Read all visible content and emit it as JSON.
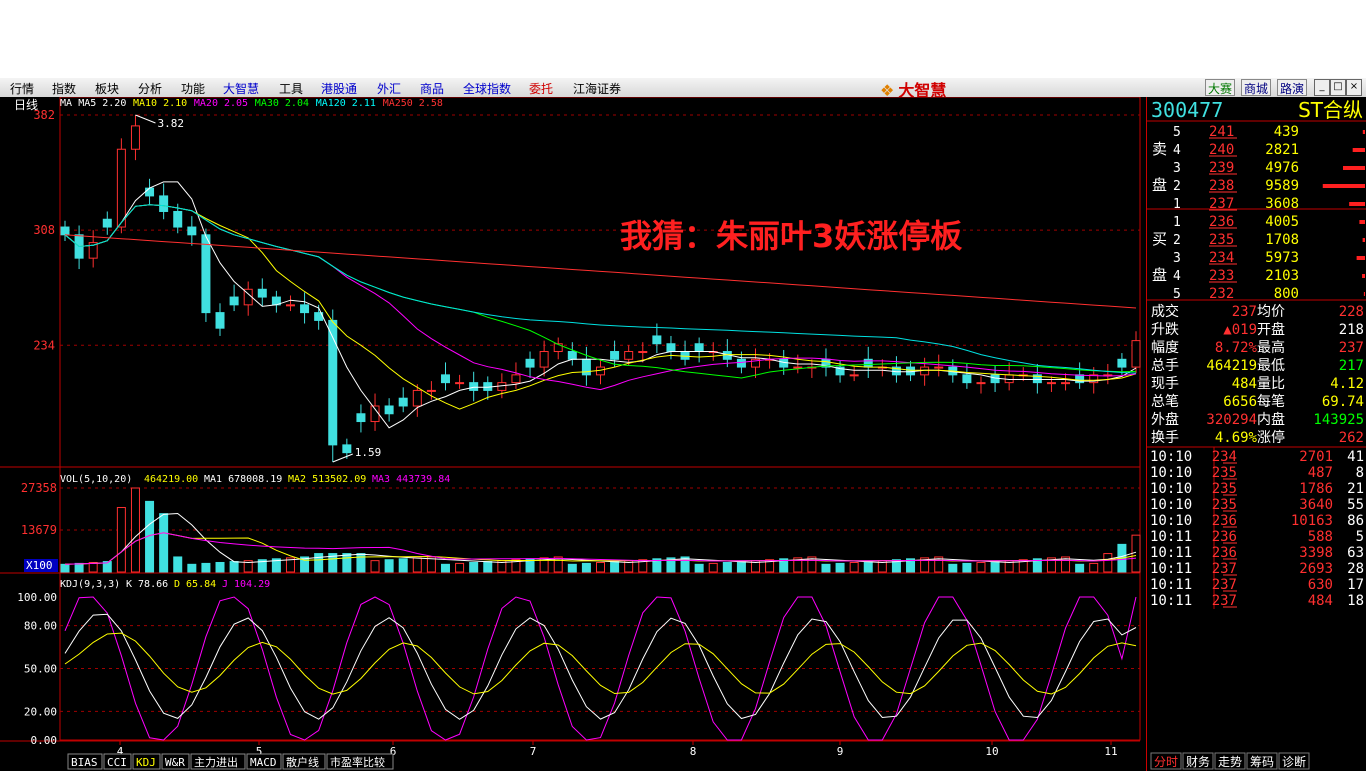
{
  "menu": [
    "行情",
    "指数",
    "板块",
    "分析",
    "功能",
    "大智慧",
    "工具",
    "港股通",
    "外汇",
    "商品",
    "全球指数",
    "委托",
    "江海证券"
  ],
  "brand": "大智慧",
  "top_right_buttons": [
    "大赛",
    "商城",
    "路演"
  ],
  "window_controls": [
    "_",
    "□",
    "×"
  ],
  "chart": {
    "period": "日线",
    "ma_line": [
      {
        "label": "MA",
        "value": "",
        "color": "#ffffff"
      },
      {
        "label": "MA5",
        "value": "2.20",
        "color": "#ffffff"
      },
      {
        "label": "MA10",
        "value": "2.10",
        "color": "#ffff00"
      },
      {
        "label": "MA20",
        "value": "2.05",
        "color": "#ff00ff"
      },
      {
        "label": "MA30",
        "value": "2.04",
        "color": "#00ff00"
      },
      {
        "label": "MA120",
        "value": "2.11",
        "color": "#00ffff"
      },
      {
        "label": "MA250",
        "value": "2.58",
        "color": "#ff3333"
      }
    ],
    "price_ticks": [
      "382",
      "308",
      "234"
    ],
    "high_label": "3.82",
    "low_label": "1.59",
    "annotation": "我猜：朱丽叶3妖涨停板",
    "vol_header": {
      "label": "VOL(5,10,20)",
      "vol": "464219.00",
      "ma1": "MA1 678008.19",
      "ma2": "MA2 513502.09",
      "ma3": "MA3 443739.84"
    },
    "vol_ticks": [
      "27358",
      "13679",
      "X100"
    ],
    "kdj_header": {
      "label": "KDJ(9,3,3)",
      "k": "K 78.66",
      "d": "D 65.84",
      "j": "J 104.29"
    },
    "kdj_ticks": [
      "100.00",
      "80.00",
      "50.00",
      "20.00",
      "0.00"
    ],
    "x_ticks": [
      "4",
      "5",
      "6",
      "7",
      "8",
      "9",
      "10",
      "11"
    ],
    "bottom_tabs": [
      "BIAS",
      "CCI",
      "KDJ",
      "W&R",
      "主力进出",
      "MACD",
      "散户线",
      "市盈率比较"
    ]
  },
  "chart_data": {
    "type": "candlestick",
    "x_ticks": [
      "4",
      "5",
      "6",
      "7",
      "8",
      "9",
      "10",
      "11"
    ],
    "ylim": [
      1.59,
      3.82
    ],
    "y_ticks": [
      3.82,
      3.08,
      2.34
    ],
    "approx_close": [
      3.05,
      2.9,
      3.0,
      3.1,
      3.6,
      3.75,
      3.3,
      3.2,
      3.1,
      3.05,
      2.55,
      2.45,
      2.6,
      2.7,
      2.65,
      2.6,
      2.6,
      2.55,
      2.5,
      1.7,
      1.65,
      1.85,
      1.95,
      1.9,
      1.95,
      2.05,
      2.05,
      2.1,
      2.1,
      2.05,
      2.05,
      2.1,
      2.15,
      2.2,
      2.3,
      2.35,
      2.25,
      2.15,
      2.2,
      2.25,
      2.3,
      2.3,
      2.35,
      2.3,
      2.25,
      2.3,
      2.3,
      2.25,
      2.2,
      2.25,
      2.25,
      2.2,
      2.2,
      2.2,
      2.2,
      2.15,
      2.15,
      2.2,
      2.2,
      2.15,
      2.15,
      2.2,
      2.2,
      2.15,
      2.1,
      2.1,
      2.1,
      2.15,
      2.15,
      2.1,
      2.1,
      2.1,
      2.1,
      2.15,
      2.15,
      2.2,
      2.37
    ]
  },
  "quote": {
    "code": "300477",
    "name": "ST合纵",
    "sell_label": [
      "卖",
      "盘"
    ],
    "buy_label": [
      "买",
      "盘"
    ],
    "sell": [
      {
        "lvl": "5",
        "price": "241",
        "vol": "439",
        "bar": 0.05
      },
      {
        "lvl": "4",
        "price": "240",
        "vol": "2821",
        "bar": 0.28
      },
      {
        "lvl": "3",
        "price": "239",
        "vol": "4976",
        "bar": 0.5
      },
      {
        "lvl": "2",
        "price": "238",
        "vol": "9589",
        "bar": 0.96
      },
      {
        "lvl": "1",
        "price": "237",
        "vol": "3608",
        "bar": 0.36
      }
    ],
    "buy": [
      {
        "lvl": "1",
        "price": "236",
        "vol": "4005",
        "bar": 0.4
      },
      {
        "lvl": "2",
        "price": "235",
        "vol": "1708",
        "bar": 0.17
      },
      {
        "lvl": "3",
        "price": "234",
        "vol": "5973",
        "bar": 0.6
      },
      {
        "lvl": "4",
        "price": "233",
        "vol": "2103",
        "bar": 0.21
      },
      {
        "lvl": "5",
        "price": "232",
        "vol": "800",
        "bar": 0.08
      }
    ],
    "stats": [
      {
        "l1": "成交",
        "v1": "237",
        "c1": "#ff3030",
        "l2": "均价",
        "v2": "228",
        "c2": "#ff3030"
      },
      {
        "l1": "升跌",
        "v1": "▲019",
        "c1": "#ff3030",
        "l2": "开盘",
        "v2": "218",
        "c2": "#ffffff"
      },
      {
        "l1": "幅度",
        "v1": "8.72%",
        "c1": "#ff3030",
        "l2": "最高",
        "v2": "237",
        "c2": "#ff3030"
      },
      {
        "l1": "总手",
        "v1": "464219",
        "c1": "#ffff00",
        "l2": "最低",
        "v2": "217",
        "c2": "#00ff00"
      },
      {
        "l1": "现手",
        "v1": "484",
        "c1": "#ffff00",
        "l2": "量比",
        "v2": "4.12",
        "c2": "#ffff00"
      },
      {
        "l1": "总笔",
        "v1": "6656",
        "c1": "#ffff00",
        "l2": "每笔",
        "v2": "69.74",
        "c2": "#ffff00"
      },
      {
        "l1": "外盘",
        "v1": "320294",
        "c1": "#ff3030",
        "l2": "内盘",
        "v2": "143925",
        "c2": "#00ff00"
      },
      {
        "l1": "换手",
        "v1": "4.69%",
        "c1": "#ffff00",
        "l2": "涨停",
        "v2": "262",
        "c2": "#ff3030"
      }
    ],
    "ticks": [
      {
        "t": "10:10",
        "p": "234",
        "v": "2701",
        "n": "41"
      },
      {
        "t": "10:10",
        "p": "235",
        "v": "487",
        "n": "8"
      },
      {
        "t": "10:10",
        "p": "235",
        "v": "1786",
        "n": "21"
      },
      {
        "t": "10:10",
        "p": "235",
        "v": "3640",
        "n": "55"
      },
      {
        "t": "10:10",
        "p": "236",
        "v": "10163",
        "n": "86"
      },
      {
        "t": "10:11",
        "p": "236",
        "v": "588",
        "n": "5"
      },
      {
        "t": "10:11",
        "p": "236",
        "v": "3398",
        "n": "63"
      },
      {
        "t": "10:11",
        "p": "237",
        "v": "2693",
        "n": "28"
      },
      {
        "t": "10:11",
        "p": "237",
        "v": "630",
        "n": "17"
      },
      {
        "t": "10:11",
        "p": "237",
        "v": "484",
        "n": "18"
      }
    ],
    "right_tabs": [
      "分时",
      "财务",
      "走势",
      "筹码",
      "诊断"
    ]
  }
}
